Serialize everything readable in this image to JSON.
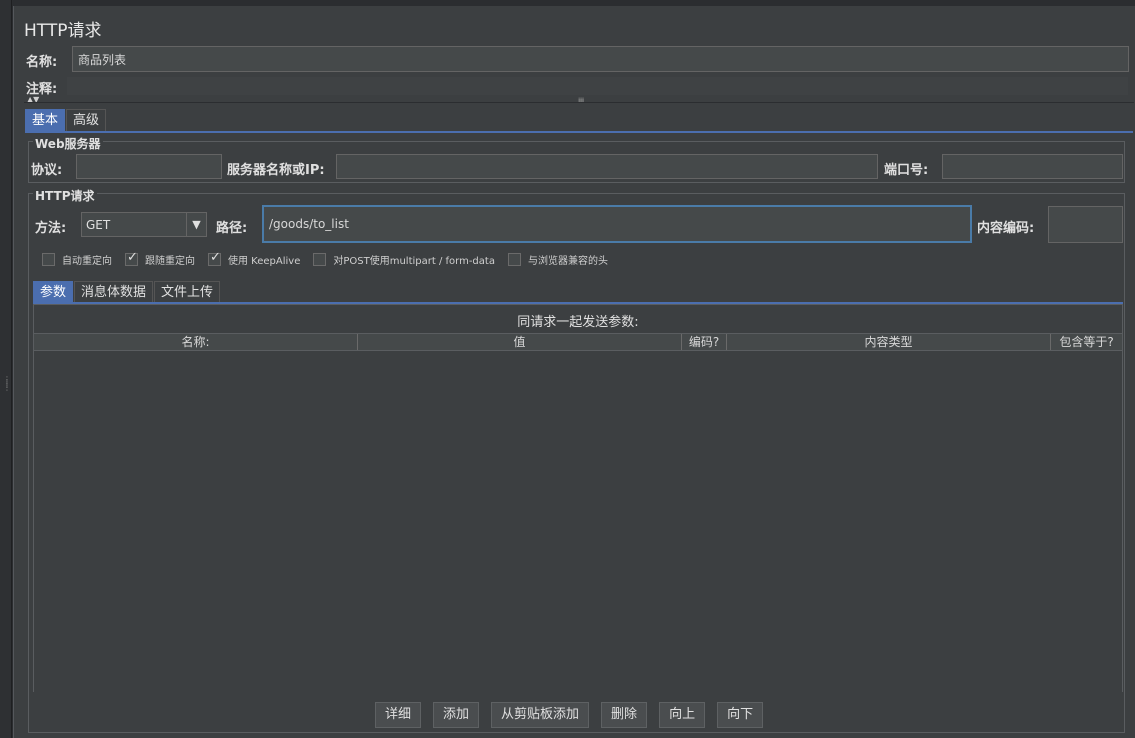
{
  "window": {
    "title": "HTTP请求"
  },
  "name_field": {
    "label": "名称:",
    "value": "商品列表"
  },
  "comment_field": {
    "label": "注释:",
    "value": ""
  },
  "main_tabs": [
    {
      "label": "基本",
      "active": true
    },
    {
      "label": "高级",
      "active": false
    }
  ],
  "web_server": {
    "group_title": "Web服务器",
    "protocol_label": "协议:",
    "protocol_value": "",
    "server_label": "服务器名称或IP:",
    "server_value": "",
    "port_label": "端口号:",
    "port_value": ""
  },
  "http_request": {
    "group_title": "HTTP请求",
    "method_label": "方法:",
    "method_value": "GET",
    "path_label": "路径:",
    "path_value": "/goods/to_list",
    "encoding_label": "内容编码:",
    "encoding_value": ""
  },
  "options": [
    {
      "label": "自动重定向",
      "checked": false
    },
    {
      "label": "跟随重定向",
      "checked": true
    },
    {
      "label": "使用 KeepAlive",
      "checked": true
    },
    {
      "label": "对POST使用multipart / form-data",
      "checked": false
    },
    {
      "label": "与浏览器兼容的头",
      "checked": false
    }
  ],
  "sub_tabs": [
    {
      "label": "参数",
      "active": true
    },
    {
      "label": "消息体数据",
      "active": false
    },
    {
      "label": "文件上传",
      "active": false
    }
  ],
  "params": {
    "caption": "同请求一起发送参数:",
    "columns": [
      "名称:",
      "值",
      "编码?",
      "内容类型",
      "包含等于?"
    ],
    "rows": []
  },
  "buttons": {
    "detail": "详细",
    "add": "添加",
    "add_clipboard": "从剪贴板添加",
    "delete": "删除",
    "up": "向上",
    "down": "向下"
  },
  "colors": {
    "background": "#3c3f41",
    "field": "#45494a",
    "accent": "#4b6eaf",
    "focus_border": "#4a7ba8",
    "text": "#e0e0e0"
  }
}
